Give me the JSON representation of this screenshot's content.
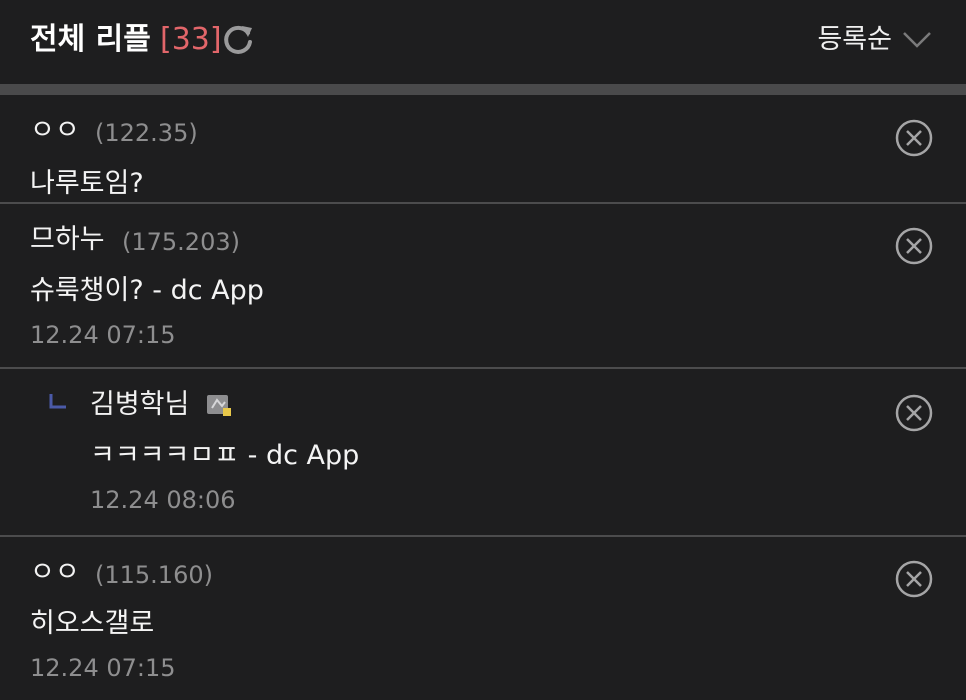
{
  "header": {
    "title": "전체 리플",
    "count": "[33]",
    "sort_label": "등록순",
    "accent_color": "#e2666a"
  },
  "comments": [
    {
      "author": "ㅇㅇ",
      "ip": "(122.35)",
      "text": "나루토임?",
      "date": ""
    },
    {
      "author": "므하누",
      "ip": "(175.203)",
      "text": "슈룩챙이? - dc App",
      "date": "12.24 07:15"
    },
    {
      "author": "김병학님",
      "ip": "",
      "text": "ㅋㅋㅋㅋㅁㅍ - dc App",
      "date": "12.24 08:06",
      "is_reply": true
    },
    {
      "author": "ㅇㅇ",
      "ip": "(115.160)",
      "text": "히오스갤로",
      "date": "12.24 07:15"
    }
  ],
  "icons": {
    "refresh": "refresh-icon",
    "sort": "chevron-down-icon",
    "delete": "close-circle-icon",
    "reply": "reply-arrow-icon",
    "gallog": "gallog-icon"
  }
}
